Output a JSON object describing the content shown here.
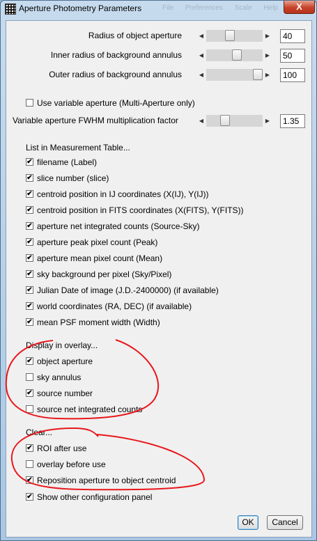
{
  "window": {
    "title": "Aperture Photometry Parameters",
    "close_label": "X"
  },
  "background_menu": [
    "File",
    "Preferences",
    "Scale",
    "Help"
  ],
  "sliders": [
    {
      "label": "Radius of object aperture",
      "value": "40",
      "level": 0.4
    },
    {
      "label": "Inner radius of background annulus",
      "value": "50",
      "level": 0.55
    },
    {
      "label": "Outer radius of background annulus",
      "value": "100",
      "level": 1.0
    }
  ],
  "variable_aperture": {
    "label": "Use variable aperture (Multi-Aperture only)",
    "checked": false
  },
  "fwhm_slider": {
    "label": "Variable aperture FWHM multiplication factor",
    "value": "1.35",
    "level": 0.3
  },
  "measurement": {
    "heading": "List in Measurement Table...",
    "items": [
      {
        "label": "filename (Label)",
        "checked": true
      },
      {
        "label": "slice number (slice)",
        "checked": true
      },
      {
        "label": "centroid position in IJ coordinates (X(IJ), Y(IJ))",
        "checked": true
      },
      {
        "label": "centroid position in FITS coordinates (X(FITS), Y(FITS))",
        "checked": true
      },
      {
        "label": "aperture net integrated counts (Source-Sky)",
        "checked": true
      },
      {
        "label": "aperture peak pixel count (Peak)",
        "checked": true
      },
      {
        "label": "aperture mean pixel count (Mean)",
        "checked": true
      },
      {
        "label": "sky background per pixel (Sky/Pixel)",
        "checked": true
      },
      {
        "label": "Julian Date of image (J.D.-2400000) (if available)",
        "checked": true
      },
      {
        "label": "world coordinates (RA, DEC) (if available)",
        "checked": true
      },
      {
        "label": "mean PSF moment width (Width)",
        "checked": true
      }
    ]
  },
  "overlay": {
    "heading": "Display in overlay...",
    "items": [
      {
        "label": "object aperture",
        "checked": true
      },
      {
        "label": "sky annulus",
        "checked": false
      },
      {
        "label": "source number",
        "checked": true
      },
      {
        "label": "source net integrated counts",
        "checked": false
      }
    ]
  },
  "clear": {
    "heading": "Clear...",
    "items": [
      {
        "label": "ROI after use",
        "checked": true
      },
      {
        "label": "overlay before use",
        "checked": false
      },
      {
        "label": "Reposition aperture to object centroid",
        "checked": true
      }
    ]
  },
  "other_config": {
    "label": "Show other configuration panel",
    "checked": true
  },
  "buttons": {
    "ok": "OK",
    "cancel": "Cancel"
  },
  "colors": {
    "annotation": "#e8171c",
    "title_bg": "#b9d1ea",
    "dialog_bg": "#f0f0f0"
  },
  "icons": {
    "check": "✔",
    "arrow_left": "◀",
    "arrow_right": "▶",
    "app": "star-field-icon"
  }
}
